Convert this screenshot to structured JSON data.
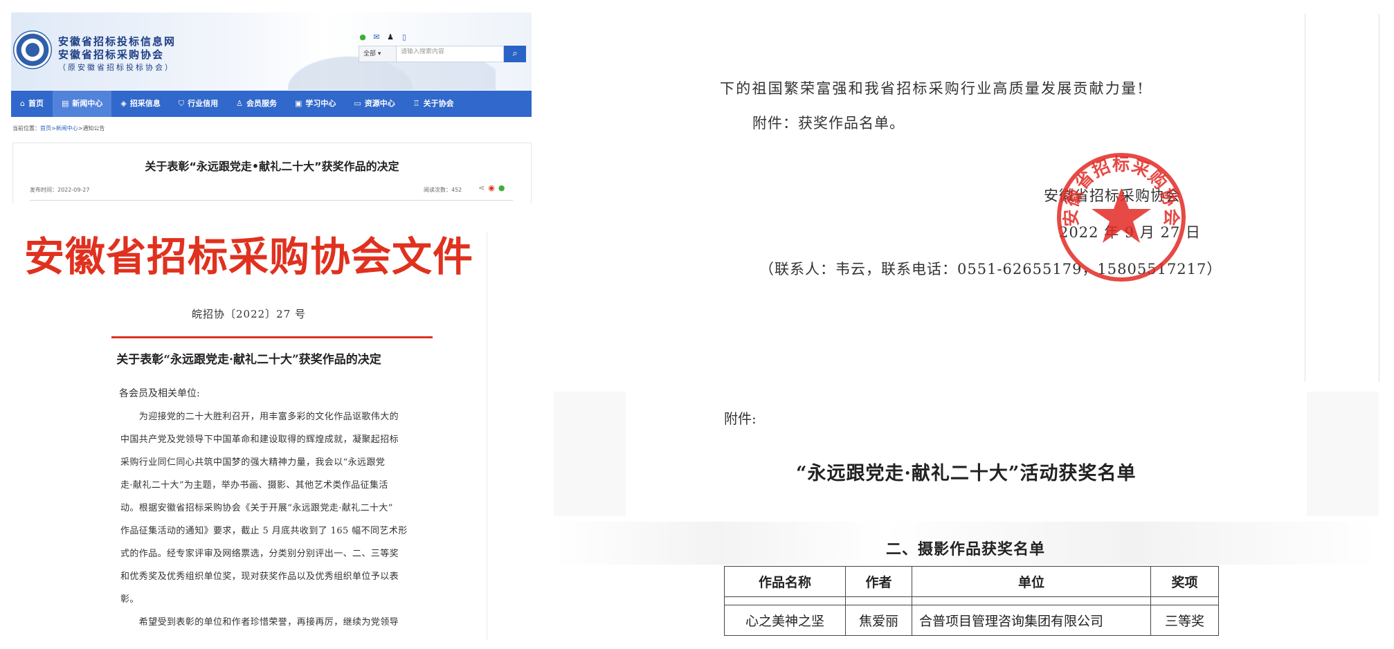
{
  "site": {
    "name_line1": "安徽省招标投标信息网",
    "name_line2": "安徽省招标采购协会",
    "name_line3": "（原安徽省招标投标协会）",
    "social_icons": [
      "wechat-icon",
      "mail-icon",
      "qq-icon",
      "mobile-icon"
    ],
    "search_scope": "全部",
    "search_placeholder": "请输入搜索内容",
    "nav": [
      {
        "icon": "home-icon",
        "glyph": "⌂",
        "label": "首页"
      },
      {
        "icon": "news-icon",
        "glyph": "▤",
        "label": "新闻中心",
        "active": true
      },
      {
        "icon": "layers-icon",
        "glyph": "◈",
        "label": "招采信息"
      },
      {
        "icon": "shield-icon",
        "glyph": "⛉",
        "label": "行业信用"
      },
      {
        "icon": "member-icon",
        "glyph": "♙",
        "label": "会员服务"
      },
      {
        "icon": "book-icon",
        "glyph": "▣",
        "label": "学习中心"
      },
      {
        "icon": "folder-icon",
        "glyph": "▭",
        "label": "资源中心"
      },
      {
        "icon": "about-icon",
        "glyph": "♖",
        "label": "关于协会"
      }
    ],
    "breadcrumb_prefix": "当前位置：",
    "breadcrumb_home": "首页",
    "breadcrumb_sep": ">",
    "breadcrumb_news": "新闻中心",
    "breadcrumb_current": "通知公告",
    "article_title": "关于表彰“永远跟党走•献礼二十大”获奖作品的决定",
    "article_date": "发布时间：2022-09-27",
    "article_views": "阅读次数：452"
  },
  "document": {
    "masthead": "安徽省招标采购协会文件",
    "number": "皖招协〔2022〕27 号",
    "title": "关于表彰“永远跟党走·献礼二十大”获奖作品的决定",
    "salutation": "各会员及相关单位:",
    "lines": [
      "　　为迎接党的二十大胜利召开，用丰富多彩的文化作品讴歌伟大的",
      "中国共产党及党领导下中国革命和建设取得的辉煌成就，凝聚起招标",
      "采购行业同仁同心共筑中国梦的强大精神力量，我会以“永远跟党",
      "走·献礼二十大”为主题，举办书画、摄影、其他艺术类作品征集活",
      "动。根据安徽省招标采购协会《关于开展“永远跟党走·献礼二十大”",
      "作品征集活动的通知》要求，截止 5 月底共收到了 165 幅不同艺术形",
      "式的作品。经专家评审及网络票选，分类别分别评出一、二、三等奖",
      "和优秀奖及优秀组织单位奖，现对获奖作品以及优秀组织单位予以表",
      "彰。",
      "　　希望受到表彰的单位和作者珍惜荣誉，再接再厉，继续为党领导"
    ]
  },
  "document_page2": {
    "line1": "下的祖国繁荣富强和我省招标采购行业高质量发展贡献力量!",
    "line2": "附件：获奖作品名单。",
    "org": "安徽省招标采购协会",
    "date": "2022 年 9 月 27 日",
    "contact": "（联系人：韦云，联系电话：0551-62655179，15805517217）",
    "seal_text": "安徽省招标采购协会"
  },
  "attachment": {
    "label": "附件:",
    "title": "“永远跟党走·献礼二十大”活动获奖名单",
    "section_title": "二、摄影作品获奖名单",
    "table_headers": [
      "作品名称",
      "作者",
      "单位",
      "奖项"
    ],
    "rows": [
      {
        "work": "心之美神之坚",
        "author": "焦爱丽",
        "unit": "合普项目管理咨询集团有限公司",
        "award": "三等奖"
      }
    ]
  },
  "colors": {
    "nav_blue": "#3168cb",
    "masthead_red": "#e0311f",
    "seal_red": "#e32a24"
  }
}
